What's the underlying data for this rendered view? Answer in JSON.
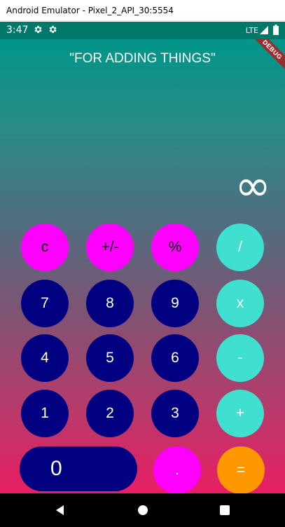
{
  "window": {
    "title": "Android Emulator - Pixel_2_API_30:5554"
  },
  "status_bar": {
    "time": "3:47",
    "network": "LTE"
  },
  "app": {
    "debug_banner": "DEBUG",
    "title": "\"FOR ADDING THINGS\"",
    "display_value": "∞",
    "buttons": {
      "clear": "c",
      "sign": "+/-",
      "percent": "%",
      "divide": "/",
      "seven": "7",
      "eight": "8",
      "nine": "9",
      "multiply": "x",
      "four": "4",
      "five": "5",
      "six": "6",
      "subtract": "-",
      "one": "1",
      "two": "2",
      "three": "3",
      "add": "+",
      "zero": "0",
      "dot": ".",
      "equals": "="
    }
  },
  "colors": {
    "status_bar": "#00796b",
    "function_button": "#ff00ff",
    "number_button": "#000080",
    "operator_button": "#40e0d0",
    "equals_button": "#ff9800",
    "gradient_top": "#009688",
    "gradient_bottom": "#e91e63"
  }
}
